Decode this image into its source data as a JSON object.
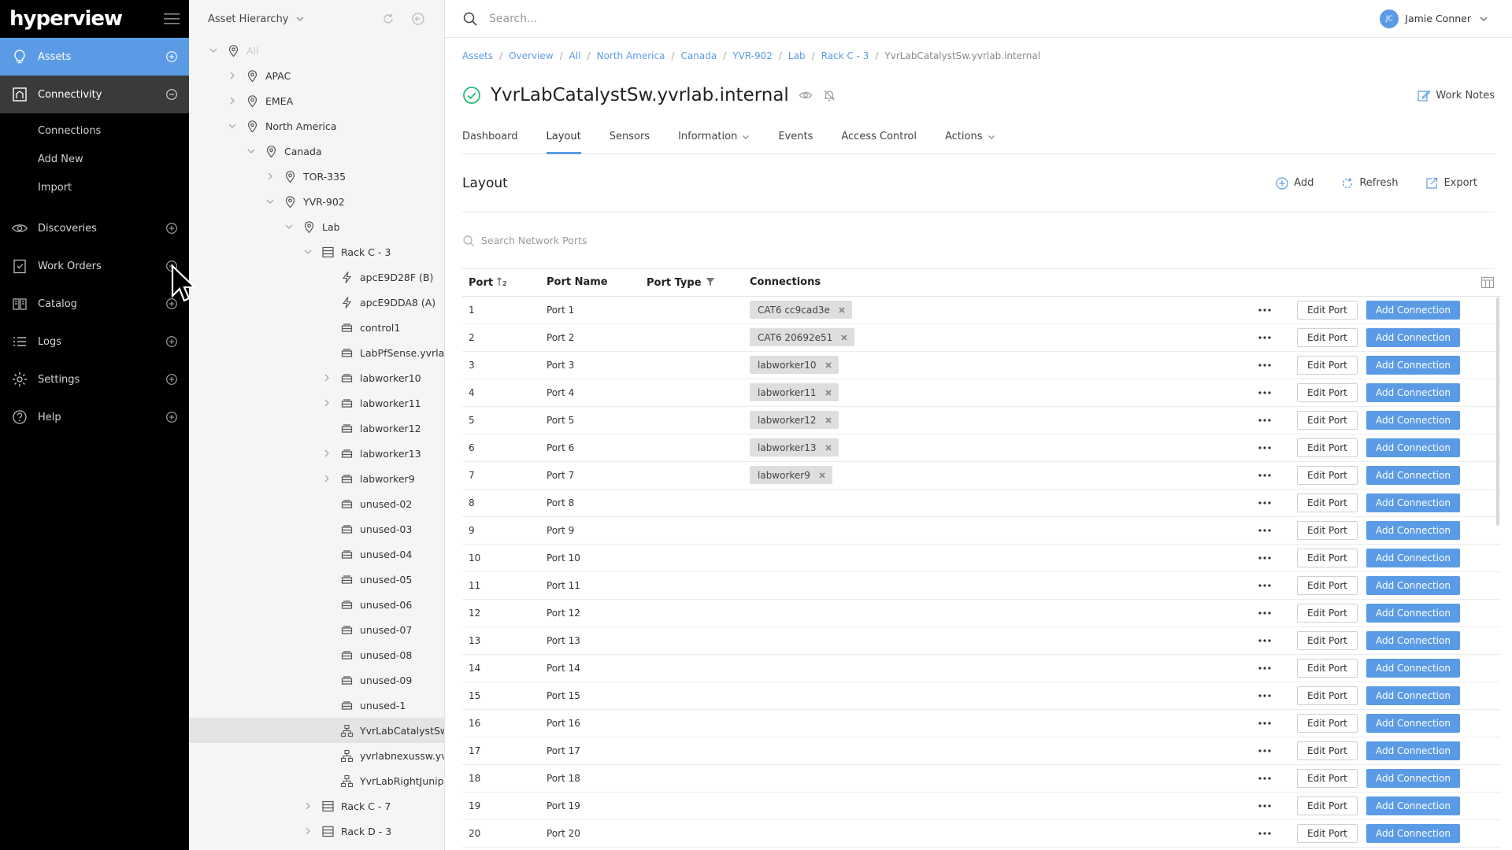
{
  "app": {
    "logo": "hyperview"
  },
  "nav": {
    "items": [
      {
        "label": "Assets",
        "icon": "bulb-icon",
        "state": "active"
      },
      {
        "label": "Connectivity",
        "icon": "building-icon",
        "state": "expanded"
      },
      {
        "label": "Discoveries",
        "icon": "eye-icon"
      },
      {
        "label": "Work Orders",
        "icon": "clipboard-icon"
      },
      {
        "label": "Catalog",
        "icon": "book-icon"
      },
      {
        "label": "Logs",
        "icon": "list-icon"
      },
      {
        "label": "Settings",
        "icon": "gear-icon"
      },
      {
        "label": "Help",
        "icon": "help-icon"
      }
    ],
    "connectivity_sub": [
      "Connections",
      "Add New",
      "Import"
    ]
  },
  "tree": {
    "header": "Asset Hierarchy",
    "nodes": [
      {
        "label": "All",
        "depth": 0,
        "icon": "location",
        "chev": "down"
      },
      {
        "label": "APAC",
        "depth": 1,
        "icon": "location",
        "chev": "right"
      },
      {
        "label": "EMEA",
        "depth": 1,
        "icon": "location",
        "chev": "right"
      },
      {
        "label": "North America",
        "depth": 1,
        "icon": "location",
        "chev": "down"
      },
      {
        "label": "Canada",
        "depth": 2,
        "icon": "location",
        "chev": "down"
      },
      {
        "label": "TOR-335",
        "depth": 3,
        "icon": "location",
        "chev": "right"
      },
      {
        "label": "YVR-902",
        "depth": 3,
        "icon": "location",
        "chev": "down"
      },
      {
        "label": "Lab",
        "depth": 4,
        "icon": "location",
        "chev": "down"
      },
      {
        "label": "Rack C - 3",
        "depth": 5,
        "icon": "rack",
        "chev": "down"
      },
      {
        "label": "apcE9D28F (B)",
        "depth": 6,
        "icon": "power",
        "chev": "none"
      },
      {
        "label": "apcE9DDA8 (A)",
        "depth": 6,
        "icon": "power",
        "chev": "none"
      },
      {
        "label": "control1",
        "depth": 6,
        "icon": "server",
        "chev": "none"
      },
      {
        "label": "LabPfSense.yvrlab",
        "depth": 6,
        "icon": "server",
        "chev": "none"
      },
      {
        "label": "labworker10",
        "depth": 6,
        "icon": "server",
        "chev": "right"
      },
      {
        "label": "labworker11",
        "depth": 6,
        "icon": "server",
        "chev": "right"
      },
      {
        "label": "labworker12",
        "depth": 6,
        "icon": "server",
        "chev": "none"
      },
      {
        "label": "labworker13",
        "depth": 6,
        "icon": "server",
        "chev": "right"
      },
      {
        "label": "labworker9",
        "depth": 6,
        "icon": "server",
        "chev": "right"
      },
      {
        "label": "unused-02",
        "depth": 6,
        "icon": "server",
        "chev": "none"
      },
      {
        "label": "unused-03",
        "depth": 6,
        "icon": "server",
        "chev": "none"
      },
      {
        "label": "unused-04",
        "depth": 6,
        "icon": "server",
        "chev": "none"
      },
      {
        "label": "unused-05",
        "depth": 6,
        "icon": "server",
        "chev": "none"
      },
      {
        "label": "unused-06",
        "depth": 6,
        "icon": "server",
        "chev": "none"
      },
      {
        "label": "unused-07",
        "depth": 6,
        "icon": "server",
        "chev": "none"
      },
      {
        "label": "unused-08",
        "depth": 6,
        "icon": "server",
        "chev": "none"
      },
      {
        "label": "unused-09",
        "depth": 6,
        "icon": "server",
        "chev": "none"
      },
      {
        "label": "unused-1",
        "depth": 6,
        "icon": "server",
        "chev": "none"
      },
      {
        "label": "YvrLabCatalystSw.",
        "depth": 6,
        "icon": "network",
        "chev": "none",
        "selected": true
      },
      {
        "label": "yvrlabnexussw.yvr",
        "depth": 6,
        "icon": "network",
        "chev": "none"
      },
      {
        "label": "YvrLabRightJunipe",
        "depth": 6,
        "icon": "network",
        "chev": "none"
      },
      {
        "label": "Rack C - 7",
        "depth": 5,
        "icon": "rack",
        "chev": "right"
      },
      {
        "label": "Rack D - 3",
        "depth": 5,
        "icon": "rack",
        "chev": "right"
      }
    ]
  },
  "search": {
    "placeholder": "Search..."
  },
  "user": {
    "initials": "JC",
    "name": "Jamie Conner"
  },
  "breadcrumbs": [
    "Assets",
    "Overview",
    "All",
    "North America",
    "Canada",
    "YVR-902",
    "Lab",
    "Rack C - 3",
    "YvrLabCatalystSw.yvrlab.internal"
  ],
  "asset": {
    "title": "YvrLabCatalystSw.yvrlab.internal",
    "work_notes": "Work Notes"
  },
  "tabs": [
    {
      "label": "Dashboard"
    },
    {
      "label": "Layout",
      "active": true
    },
    {
      "label": "Sensors"
    },
    {
      "label": "Information",
      "dropdown": true
    },
    {
      "label": "Events"
    },
    {
      "label": "Access Control"
    },
    {
      "label": "Actions",
      "dropdown": true
    }
  ],
  "layout": {
    "title": "Layout",
    "actions": {
      "add": "Add",
      "refresh": "Refresh",
      "export": "Export"
    },
    "port_search_placeholder": "Search Network Ports"
  },
  "table": {
    "headers": {
      "port": "Port",
      "name": "Port Name",
      "type": "Port Type",
      "connections": "Connections"
    },
    "edit_label": "Edit Port",
    "add_label": "Add Connection",
    "rows": [
      {
        "port": "1",
        "name": "Port 1",
        "connection": "CAT6 cc9cad3e"
      },
      {
        "port": "2",
        "name": "Port 2",
        "connection": "CAT6 20692e51"
      },
      {
        "port": "3",
        "name": "Port 3",
        "connection": "labworker10"
      },
      {
        "port": "4",
        "name": "Port 4",
        "connection": "labworker11"
      },
      {
        "port": "5",
        "name": "Port 5",
        "connection": "labworker12"
      },
      {
        "port": "6",
        "name": "Port 6",
        "connection": "labworker13"
      },
      {
        "port": "7",
        "name": "Port 7",
        "connection": "labworker9"
      },
      {
        "port": "8",
        "name": "Port 8",
        "connection": ""
      },
      {
        "port": "9",
        "name": "Port 9",
        "connection": ""
      },
      {
        "port": "10",
        "name": "Port 10",
        "connection": ""
      },
      {
        "port": "11",
        "name": "Port 11",
        "connection": ""
      },
      {
        "port": "12",
        "name": "Port 12",
        "connection": ""
      },
      {
        "port": "13",
        "name": "Port 13",
        "connection": ""
      },
      {
        "port": "14",
        "name": "Port 14",
        "connection": ""
      },
      {
        "port": "15",
        "name": "Port 15",
        "connection": ""
      },
      {
        "port": "16",
        "name": "Port 16",
        "connection": ""
      },
      {
        "port": "17",
        "name": "Port 17",
        "connection": ""
      },
      {
        "port": "18",
        "name": "Port 18",
        "connection": ""
      },
      {
        "port": "19",
        "name": "Port 19",
        "connection": ""
      },
      {
        "port": "20",
        "name": "Port 20",
        "connection": ""
      }
    ]
  },
  "colors": {
    "accent": "#5b9be6",
    "nav_bg": "#000000",
    "status_ok": "#2eb872"
  }
}
